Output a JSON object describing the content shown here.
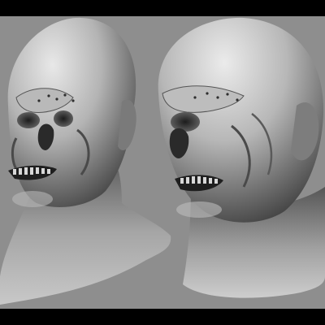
{
  "scene": {
    "subject": "sculpted-alien-head-bust",
    "views": [
      "front-three-quarter-view",
      "side-three-quarter-view"
    ],
    "colors": {
      "background": "#8e8e8e",
      "frame": "#000000",
      "clay_light": "#e6e6e6",
      "clay_mid": "#a9a9a9",
      "clay_dark": "#3a3a3a"
    }
  }
}
